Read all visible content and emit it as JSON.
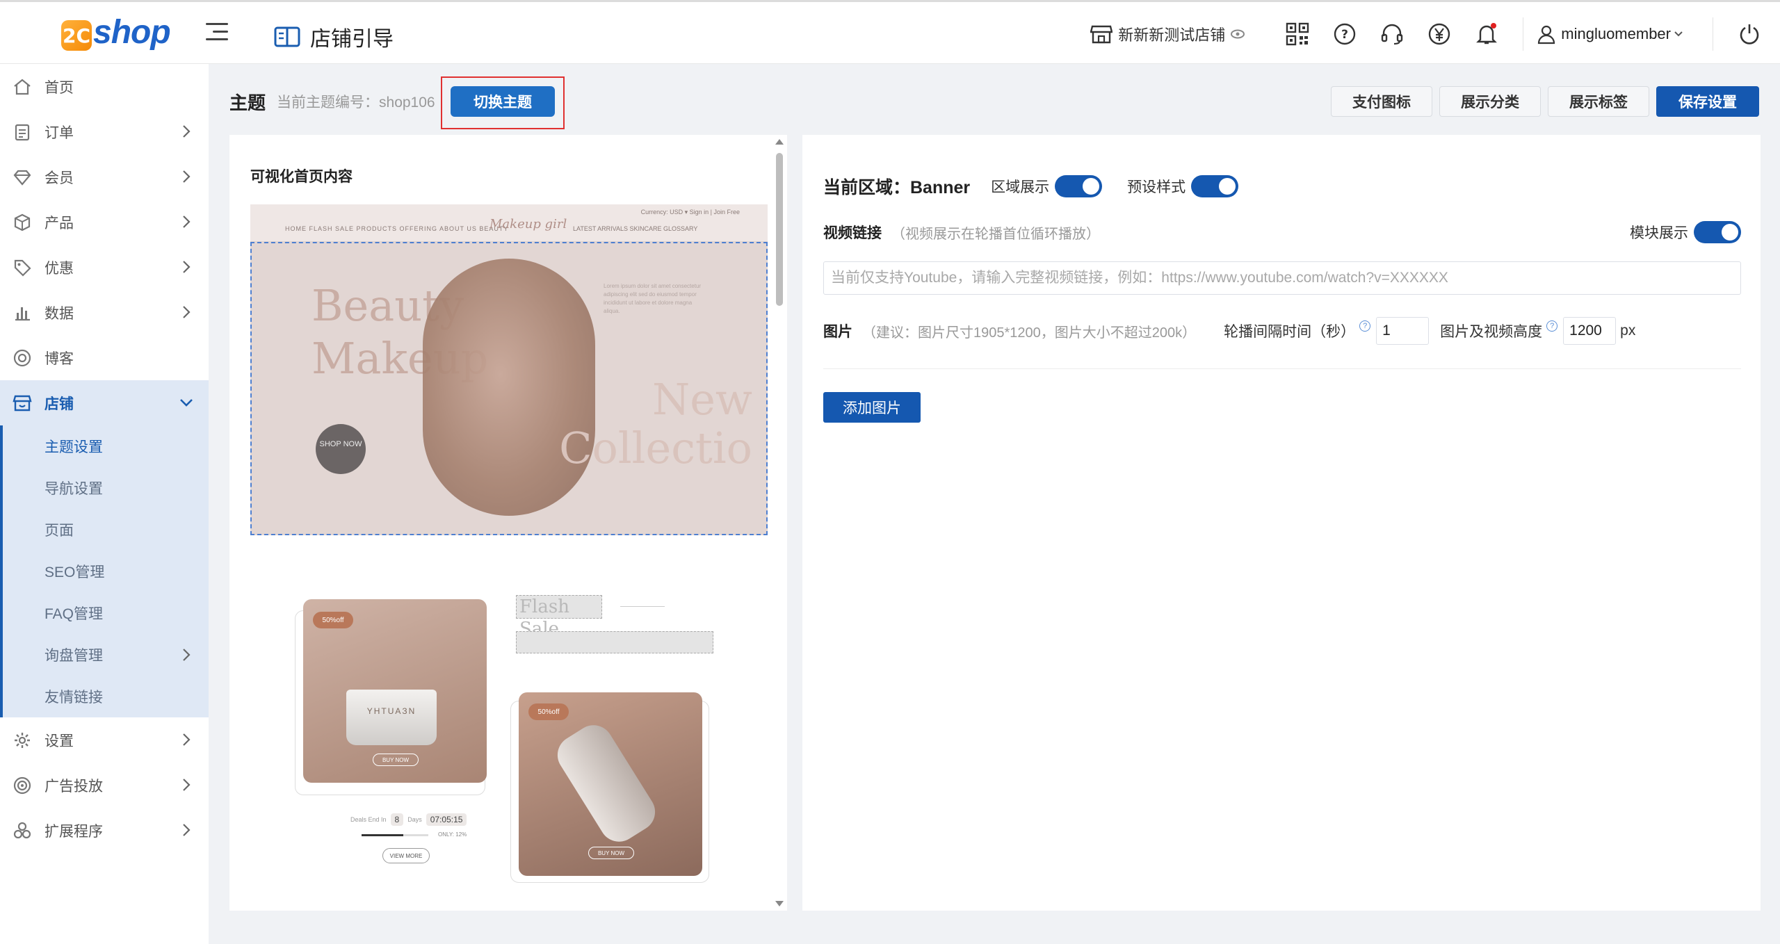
{
  "brand": {
    "logo_mark": "2C",
    "logo_text": "shop"
  },
  "header": {
    "page_title": "店铺引导",
    "store_name": "新新新测试店铺",
    "username": "mingluomember",
    "icons": [
      "store-icon",
      "eye-icon",
      "qrcode-icon",
      "help-icon",
      "headset-icon",
      "yen-icon",
      "bell-icon",
      "user-icon",
      "power-icon"
    ]
  },
  "sidebar": {
    "items": [
      {
        "label": "首页",
        "icon": "home-icon",
        "has_children": false
      },
      {
        "label": "订单",
        "icon": "order-icon",
        "has_children": true
      },
      {
        "label": "会员",
        "icon": "diamond-icon",
        "has_children": true
      },
      {
        "label": "产品",
        "icon": "box-icon",
        "has_children": true
      },
      {
        "label": "优惠",
        "icon": "tag-icon",
        "has_children": true
      },
      {
        "label": "数据",
        "icon": "bar-chart-icon",
        "has_children": true
      },
      {
        "label": "博客",
        "icon": "blog-icon",
        "has_children": false
      },
      {
        "label": "店铺",
        "icon": "shop-icon",
        "has_children": true,
        "expanded": true
      },
      {
        "label": "设置",
        "icon": "gear-icon",
        "has_children": true
      },
      {
        "label": "广告投放",
        "icon": "target-icon",
        "has_children": true
      },
      {
        "label": "扩展程序",
        "icon": "extension-icon",
        "has_children": true
      }
    ],
    "shop_children": [
      {
        "label": "主题设置",
        "current": true
      },
      {
        "label": "导航设置"
      },
      {
        "label": "页面"
      },
      {
        "label": "SEO管理"
      },
      {
        "label": "FAQ管理"
      },
      {
        "label": "询盘管理",
        "has_children": true
      },
      {
        "label": "友情链接"
      }
    ]
  },
  "theme": {
    "title": "主题",
    "code_label": "当前主题编号：shop106",
    "switch_label": "切换主题"
  },
  "actions": {
    "pay_icons": "支付图标",
    "show_category": "展示分类",
    "show_tags": "展示标签",
    "save": "保存设置"
  },
  "preview": {
    "title": "可视化首页内容",
    "mock": {
      "nav_links": "HOME   FLASH SALE   PRODUCTS OFFERING   ABOUT US   BEAUTY",
      "brand": "Makeup girl",
      "nav_links_right": "LATEST ARRIVALS   SKINCARE   GLOSSARY",
      "currency": "Currency: USD ▾   Sign in   |   Join Free",
      "banner_line1": "Beauty",
      "banner_line2": "Makeup",
      "banner_line3": "New",
      "banner_line4": "Collectio",
      "shop_now": "SHOP NOW",
      "blurb": "Lorem ipsum dolor sit amet consectetur adipiscing elit sed do eiusmod tempor incididunt ut labore et dolore magna aliqua.",
      "badge1": "50%off",
      "badge2": "50%off",
      "jar_label": "YHTUAЗN",
      "buy_now": "BUY NOW",
      "flash_sale": "Flash Sale",
      "timer_label": "Deals End In",
      "timer_days": "8",
      "timer_days_label": "Days",
      "timer_time": "07:05:15",
      "only_left": "ONLY: 12%",
      "view_more": "VIEW MORE",
      "progress": 0.62
    }
  },
  "settings": {
    "region_label": "当前区域：Banner",
    "region_display_label": "区域展示",
    "region_display_on": true,
    "preset_style_label": "预设样式",
    "preset_style_on": true,
    "video_label": "视频链接",
    "video_hint": "（视频展示在轮播首位循环播放）",
    "module_display_label": "模块展示",
    "module_display_on": true,
    "video_placeholder": "当前仅支持Youtube，请输入完整视频链接，例如：https://www.youtube.com/watch?v=XXXXXX",
    "video_value": "",
    "image_label": "图片",
    "image_hint": "（建议：图片尺寸1905*1200，图片大小不超过200k）",
    "interval_label": "轮播间隔时间（秒）",
    "interval_value": "1",
    "height_label": "图片及视频高度",
    "height_value": "1200",
    "height_unit": "px",
    "add_image": "添加图片"
  },
  "colors": {
    "primary": "#1558b0",
    "switch_btn": "#1f6fc4",
    "highlight_border": "#e03030",
    "sidebar_active_bg": "#dfe8f5"
  }
}
